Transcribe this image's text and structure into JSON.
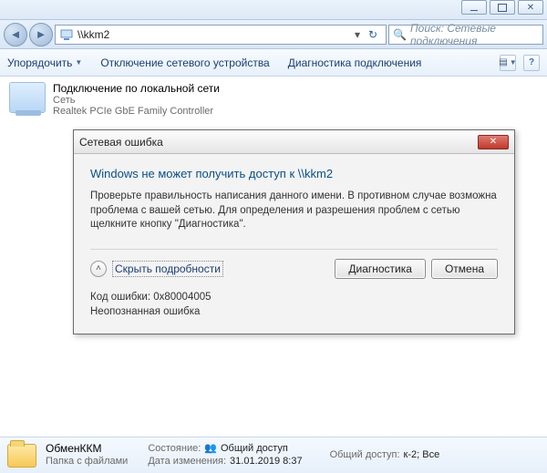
{
  "chrome": {
    "minimize": "_",
    "maximize": "▢",
    "close": "✕"
  },
  "nav": {
    "path": "\\\\kkm2",
    "search_placeholder": "Поиск: Сетевые подключения"
  },
  "toolbar": {
    "organize": "Упорядочить",
    "disable": "Отключение сетевого устройства",
    "diagnose": "Диагностика подключения"
  },
  "item": {
    "title": "Подключение по локальной сети",
    "subtitle": "Сеть",
    "adapter": "Realtek PCIe GbE Family Controller"
  },
  "dialog": {
    "title": "Сетевая ошибка",
    "heading": "Windows не может получить доступ к \\\\kkm2",
    "body": "Проверьте правильность написания данного имени. В противном случае возможна проблема с вашей сетью. Для определения и разрешения проблем с сетью щелкните кнопку \"Диагностика\".",
    "toggle": "Скрыть подробности",
    "btn_diagnose": "Диагностика",
    "btn_cancel": "Отмена",
    "err_code": "Код ошибки: 0x80004005",
    "err_msg": "Неопознанная ошибка"
  },
  "footer": {
    "name": "ОбменККМ",
    "folder_line": "Папка с файлами",
    "state_lbl": "Состояние:",
    "state_val": "Общий доступ",
    "date_lbl": "Дата изменения:",
    "date_val": "31.01.2019 8:37",
    "share_lbl": "Общий доступ:",
    "share_val": "к-2; Все"
  }
}
